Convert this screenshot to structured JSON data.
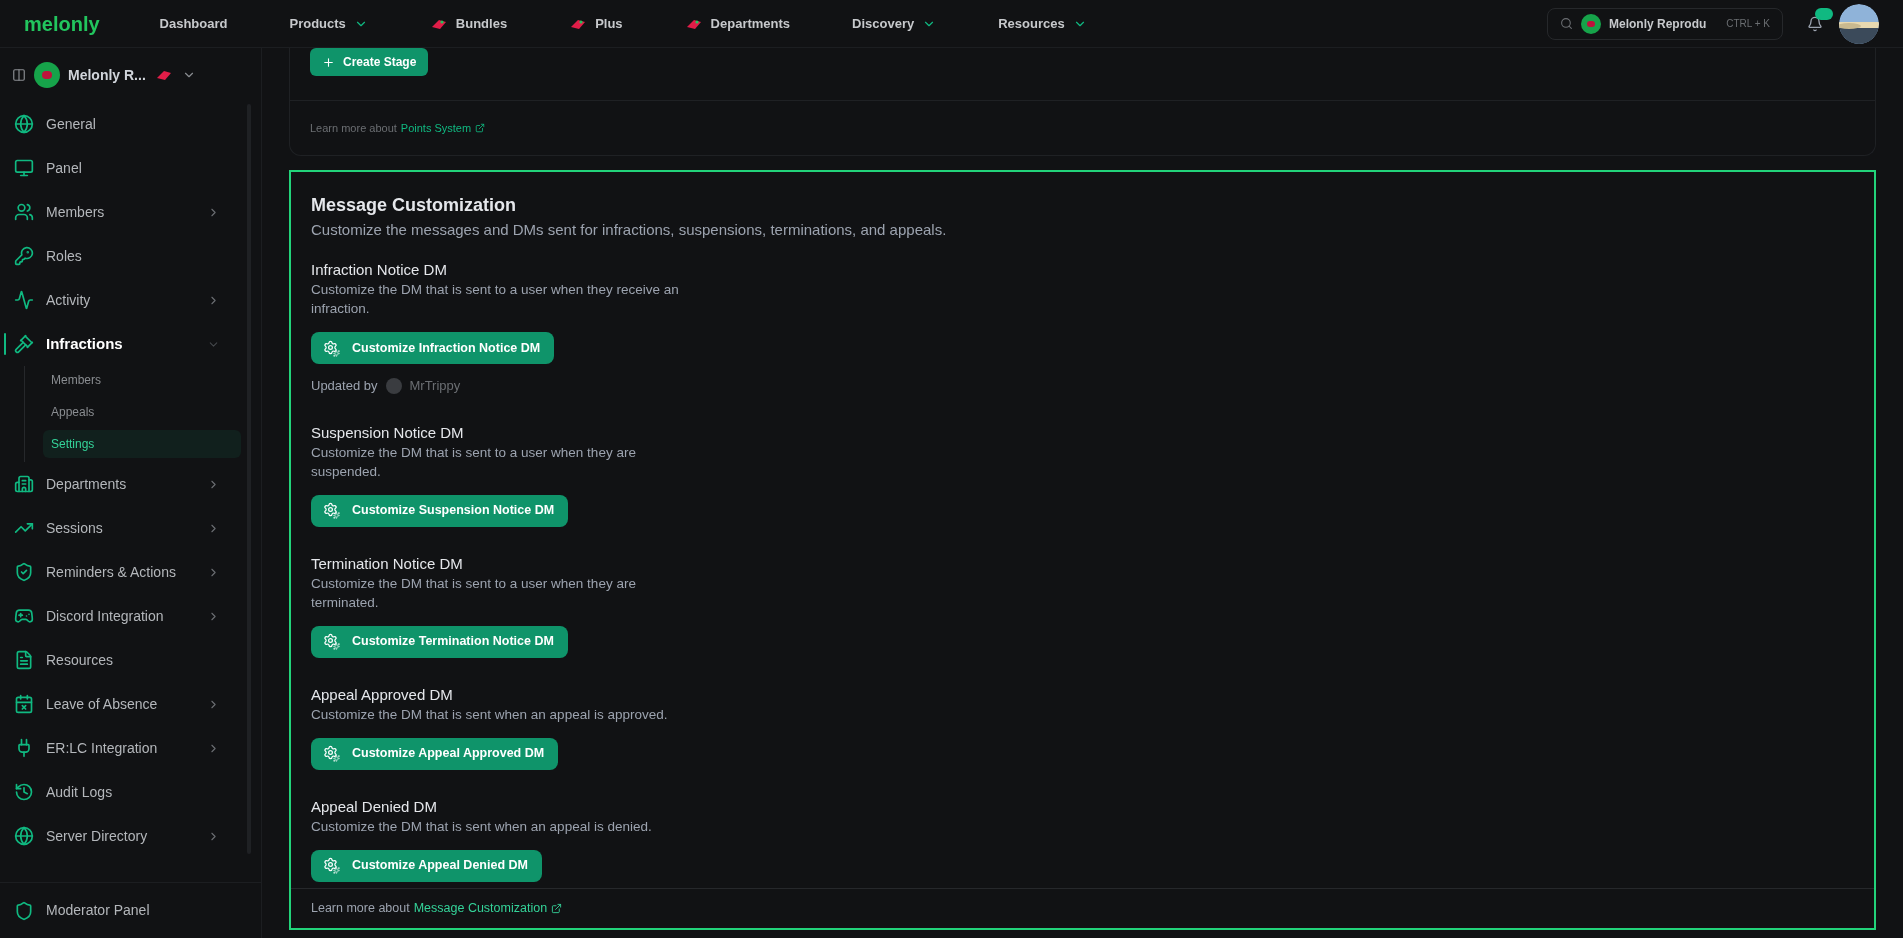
{
  "topbar": {
    "logo": "melonly",
    "nav": [
      {
        "label": "Dashboard",
        "kind": "link"
      },
      {
        "label": "Products",
        "kind": "menu"
      },
      {
        "label": "Bundles",
        "kind": "icon"
      },
      {
        "label": "Plus",
        "kind": "icon"
      },
      {
        "label": "Departments",
        "kind": "icon"
      },
      {
        "label": "Discovery",
        "kind": "menu"
      },
      {
        "label": "Resources",
        "kind": "menu"
      }
    ],
    "search": {
      "server": "Melonly Reprodu",
      "shortcut": "CTRL + K"
    }
  },
  "sidebar": {
    "server": "Melonly R...",
    "items": [
      {
        "label": "General",
        "kind": "link",
        "selected": false
      },
      {
        "label": "Panel",
        "kind": "link",
        "selected": false
      },
      {
        "label": "Members",
        "kind": "group",
        "expanded": false,
        "selected": false
      },
      {
        "label": "Roles",
        "kind": "link",
        "selected": false
      },
      {
        "label": "Activity",
        "kind": "group",
        "expanded": false,
        "selected": false
      },
      {
        "label": "Infractions",
        "kind": "group",
        "expanded": true,
        "selected": true,
        "children": [
          {
            "label": "Members",
            "selected": false
          },
          {
            "label": "Appeals",
            "selected": false
          },
          {
            "label": "Settings",
            "selected": true
          }
        ]
      },
      {
        "label": "Departments",
        "kind": "group",
        "expanded": false,
        "selected": false
      },
      {
        "label": "Sessions",
        "kind": "group",
        "expanded": false,
        "selected": false
      },
      {
        "label": "Reminders & Actions",
        "kind": "group",
        "expanded": false,
        "selected": false
      },
      {
        "label": "Discord Integration",
        "kind": "group",
        "expanded": false,
        "selected": false
      },
      {
        "label": "Resources",
        "kind": "link",
        "selected": false
      },
      {
        "label": "Leave of Absence",
        "kind": "group",
        "expanded": false,
        "selected": false
      },
      {
        "label": "ER:LC Integration",
        "kind": "group",
        "expanded": false,
        "selected": false
      },
      {
        "label": "Audit Logs",
        "kind": "link",
        "selected": false
      },
      {
        "label": "Server Directory",
        "kind": "group",
        "expanded": false,
        "selected": false
      }
    ],
    "footer": "Moderator Panel"
  },
  "previous_card": {
    "button": "Create Stage",
    "learn_prefix": "Learn more about",
    "learn_link": "Points System"
  },
  "card": {
    "title": "Message Customization",
    "description": "Customize the messages and DMs sent for infractions, suspensions, terminations, and appeals.",
    "sections": [
      {
        "title": "Infraction Notice DM",
        "description": "Customize the DM that is sent to a user when they receive an infraction.",
        "button": "Customize Infraction Notice DM",
        "updated_by": "Updated by",
        "updated_user": "MrTrippy"
      },
      {
        "title": "Suspension Notice DM",
        "description": "Customize the DM that is sent to a user when they are suspended.",
        "button": "Customize Suspension Notice DM"
      },
      {
        "title": "Termination Notice DM",
        "description": "Customize the DM that is sent to a user when they are terminated.",
        "button": "Customize Termination Notice DM"
      },
      {
        "title": "Appeal Approved DM",
        "description": "Customize the DM that is sent when an appeal is approved.",
        "button": "Customize Appeal Approved DM"
      },
      {
        "title": "Appeal Denied DM",
        "description": "Customize the DM that is sent when an appeal is denied.",
        "button": "Customize Appeal Denied DM"
      }
    ],
    "learn_prefix": "Learn more about",
    "learn_link": "Message Customization"
  }
}
